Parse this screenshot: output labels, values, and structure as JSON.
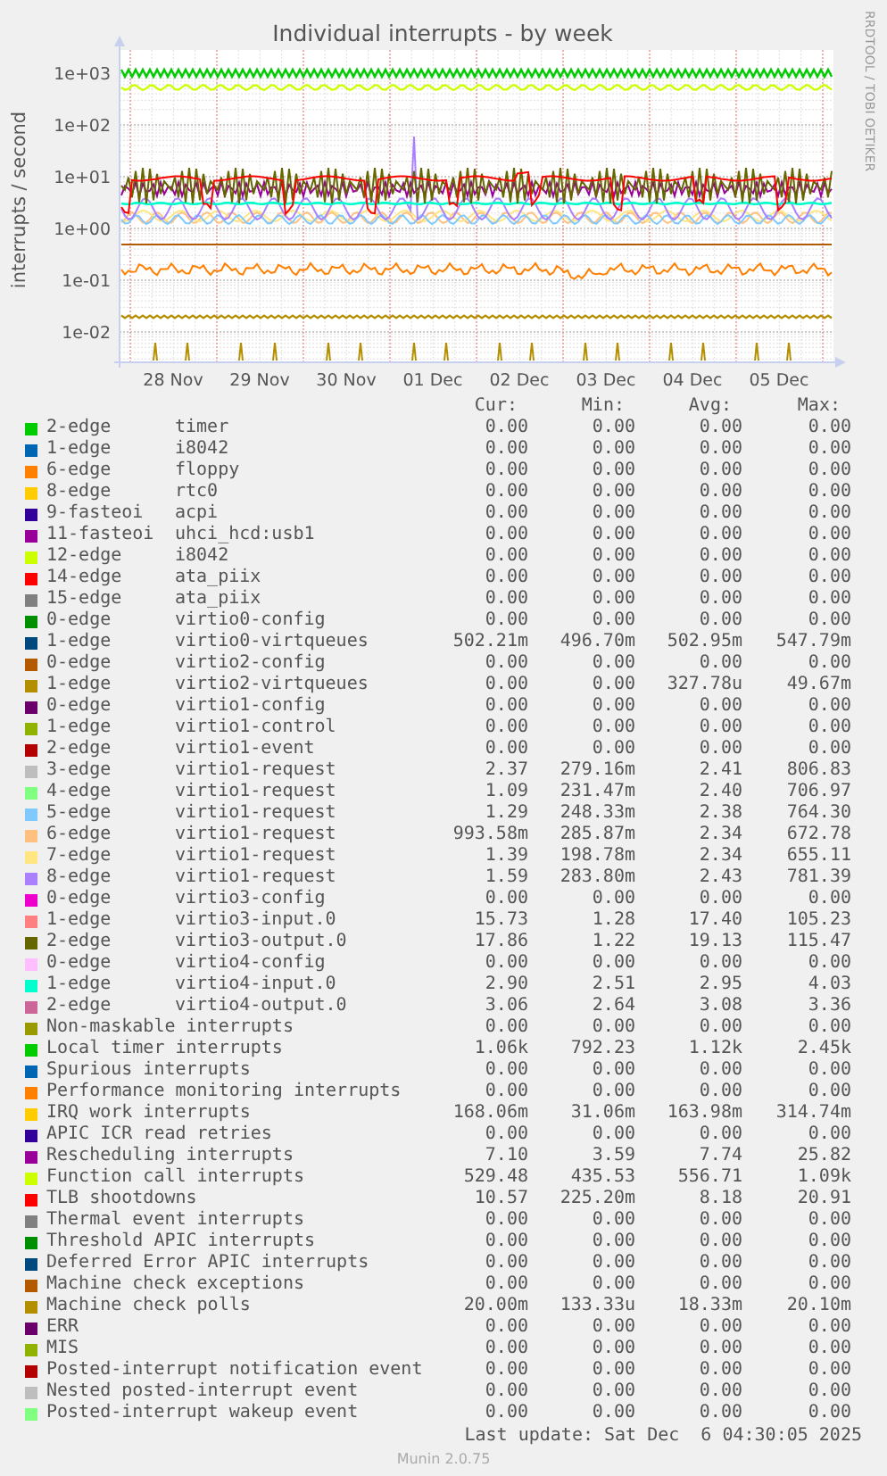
{
  "graph": {
    "title": "Individual interrupts - by week",
    "ylabel": "interrupts / second",
    "credit": "RRDTOOL / TOBI OETIKER",
    "y_tick_labels": [
      "1e+03",
      "1e+02",
      "1e+01",
      "1e+00",
      "1e-01",
      "1e-02"
    ],
    "x_tick_labels": [
      "28 Nov",
      "29 Nov",
      "30 Nov",
      "01 Dec",
      "02 Dec",
      "03 Dec",
      "04 Dec",
      "05 Dec"
    ]
  },
  "legend": {
    "columns": [
      "Cur:",
      "Min:",
      "Avg:",
      "Max:"
    ],
    "rows": [
      {
        "color": "#00cc00",
        "label": "2-edge",
        "name": "timer",
        "cur": "0.00",
        "min": "0.00",
        "avg": "0.00",
        "max": "0.00"
      },
      {
        "color": "#0066b3",
        "label": "1-edge",
        "name": "i8042",
        "cur": "0.00",
        "min": "0.00",
        "avg": "0.00",
        "max": "0.00"
      },
      {
        "color": "#ff8000",
        "label": "6-edge",
        "name": "floppy",
        "cur": "0.00",
        "min": "0.00",
        "avg": "0.00",
        "max": "0.00"
      },
      {
        "color": "#ffcc00",
        "label": "8-edge",
        "name": "rtc0",
        "cur": "0.00",
        "min": "0.00",
        "avg": "0.00",
        "max": "0.00"
      },
      {
        "color": "#330099",
        "label": "9-fasteoi",
        "name": "acpi",
        "cur": "0.00",
        "min": "0.00",
        "avg": "0.00",
        "max": "0.00"
      },
      {
        "color": "#990099",
        "label": "11-fasteoi",
        "name": "uhci_hcd:usb1",
        "cur": "0.00",
        "min": "0.00",
        "avg": "0.00",
        "max": "0.00"
      },
      {
        "color": "#ccff00",
        "label": "12-edge",
        "name": "i8042",
        "cur": "0.00",
        "min": "0.00",
        "avg": "0.00",
        "max": "0.00"
      },
      {
        "color": "#ff0000",
        "label": "14-edge",
        "name": "ata_piix",
        "cur": "0.00",
        "min": "0.00",
        "avg": "0.00",
        "max": "0.00"
      },
      {
        "color": "#808080",
        "label": "15-edge",
        "name": "ata_piix",
        "cur": "0.00",
        "min": "0.00",
        "avg": "0.00",
        "max": "0.00"
      },
      {
        "color": "#008f00",
        "label": "0-edge",
        "name": "virtio0-config",
        "cur": "0.00",
        "min": "0.00",
        "avg": "0.00",
        "max": "0.00"
      },
      {
        "color": "#00487d",
        "label": "1-edge",
        "name": "virtio0-virtqueues",
        "cur": "502.21m",
        "min": "496.70m",
        "avg": "502.95m",
        "max": "547.79m"
      },
      {
        "color": "#b35a00",
        "label": "0-edge",
        "name": "virtio2-config",
        "cur": "0.00",
        "min": "0.00",
        "avg": "0.00",
        "max": "0.00"
      },
      {
        "color": "#b38f00",
        "label": "1-edge",
        "name": "virtio2-virtqueues",
        "cur": "0.00",
        "min": "0.00",
        "avg": "327.78u",
        "max": "49.67m"
      },
      {
        "color": "#6b006b",
        "label": "0-edge",
        "name": "virtio1-config",
        "cur": "0.00",
        "min": "0.00",
        "avg": "0.00",
        "max": "0.00"
      },
      {
        "color": "#8fb300",
        "label": "1-edge",
        "name": "virtio1-control",
        "cur": "0.00",
        "min": "0.00",
        "avg": "0.00",
        "max": "0.00"
      },
      {
        "color": "#b30000",
        "label": "2-edge",
        "name": "virtio1-event",
        "cur": "0.00",
        "min": "0.00",
        "avg": "0.00",
        "max": "0.00"
      },
      {
        "color": "#bebebe",
        "label": "3-edge",
        "name": "virtio1-request",
        "cur": "2.37",
        "min": "279.16m",
        "avg": "2.41",
        "max": "806.83"
      },
      {
        "color": "#80ff80",
        "label": "4-edge",
        "name": "virtio1-request",
        "cur": "1.09",
        "min": "231.47m",
        "avg": "2.40",
        "max": "706.97"
      },
      {
        "color": "#80c9ff",
        "label": "5-edge",
        "name": "virtio1-request",
        "cur": "1.29",
        "min": "248.33m",
        "avg": "2.38",
        "max": "764.30"
      },
      {
        "color": "#ffc080",
        "label": "6-edge",
        "name": "virtio1-request",
        "cur": "993.58m",
        "min": "285.87m",
        "avg": "2.34",
        "max": "672.78"
      },
      {
        "color": "#ffe680",
        "label": "7-edge",
        "name": "virtio1-request",
        "cur": "1.39",
        "min": "198.78m",
        "avg": "2.34",
        "max": "655.11"
      },
      {
        "color": "#aa80ff",
        "label": "8-edge",
        "name": "virtio1-request",
        "cur": "1.59",
        "min": "283.80m",
        "avg": "2.43",
        "max": "781.39"
      },
      {
        "color": "#ee00cc",
        "label": "0-edge",
        "name": "virtio3-config",
        "cur": "0.00",
        "min": "0.00",
        "avg": "0.00",
        "max": "0.00"
      },
      {
        "color": "#ff8080",
        "label": "1-edge",
        "name": "virtio3-input.0",
        "cur": "15.73",
        "min": "1.28",
        "avg": "17.40",
        "max": "105.23"
      },
      {
        "color": "#666600",
        "label": "2-edge",
        "name": "virtio3-output.0",
        "cur": "17.86",
        "min": "1.22",
        "avg": "19.13",
        "max": "115.47"
      },
      {
        "color": "#ffbfff",
        "label": "0-edge",
        "name": "virtio4-config",
        "cur": "0.00",
        "min": "0.00",
        "avg": "0.00",
        "max": "0.00"
      },
      {
        "color": "#00ffcc",
        "label": "1-edge",
        "name": "virtio4-input.0",
        "cur": "2.90",
        "min": "2.51",
        "avg": "2.95",
        "max": "4.03"
      },
      {
        "color": "#cc6699",
        "label": "2-edge",
        "name": "virtio4-output.0",
        "cur": "3.06",
        "min": "2.64",
        "avg": "3.08",
        "max": "3.36"
      },
      {
        "color": "#999900",
        "label": "Non-maskable interrupts",
        "cur": "0.00",
        "min": "0.00",
        "avg": "0.00",
        "max": "0.00"
      },
      {
        "color": "#00cc00",
        "label": "Local timer interrupts",
        "cur": "1.06k",
        "min": "792.23",
        "avg": "1.12k",
        "max": "2.45k"
      },
      {
        "color": "#0066b3",
        "label": "Spurious interrupts",
        "cur": "0.00",
        "min": "0.00",
        "avg": "0.00",
        "max": "0.00"
      },
      {
        "color": "#ff8000",
        "label": "Performance monitoring interrupts",
        "cur": "0.00",
        "min": "0.00",
        "avg": "0.00",
        "max": "0.00"
      },
      {
        "color": "#ffcc00",
        "label": "IRQ work interrupts",
        "cur": "168.06m",
        "min": "31.06m",
        "avg": "163.98m",
        "max": "314.74m"
      },
      {
        "color": "#330099",
        "label": "APIC ICR read retries",
        "cur": "0.00",
        "min": "0.00",
        "avg": "0.00",
        "max": "0.00"
      },
      {
        "color": "#990099",
        "label": "Rescheduling interrupts",
        "cur": "7.10",
        "min": "3.59",
        "avg": "7.74",
        "max": "25.82"
      },
      {
        "color": "#ccff00",
        "label": "Function call interrupts",
        "cur": "529.48",
        "min": "435.53",
        "avg": "556.71",
        "max": "1.09k"
      },
      {
        "color": "#ff0000",
        "label": "TLB shootdowns",
        "cur": "10.57",
        "min": "225.20m",
        "avg": "8.18",
        "max": "20.91"
      },
      {
        "color": "#808080",
        "label": "Thermal event interrupts",
        "cur": "0.00",
        "min": "0.00",
        "avg": "0.00",
        "max": "0.00"
      },
      {
        "color": "#008f00",
        "label": "Threshold APIC interrupts",
        "cur": "0.00",
        "min": "0.00",
        "avg": "0.00",
        "max": "0.00"
      },
      {
        "color": "#00487d",
        "label": "Deferred Error APIC interrupts",
        "cur": "0.00",
        "min": "0.00",
        "avg": "0.00",
        "max": "0.00"
      },
      {
        "color": "#b35a00",
        "label": "Machine check exceptions",
        "cur": "0.00",
        "min": "0.00",
        "avg": "0.00",
        "max": "0.00"
      },
      {
        "color": "#b38f00",
        "label": "Machine check polls",
        "cur": "20.00m",
        "min": "133.33u",
        "avg": "18.33m",
        "max": "20.10m"
      },
      {
        "color": "#6b006b",
        "label": "ERR",
        "cur": "0.00",
        "min": "0.00",
        "avg": "0.00",
        "max": "0.00"
      },
      {
        "color": "#8fb300",
        "label": "MIS",
        "cur": "0.00",
        "min": "0.00",
        "avg": "0.00",
        "max": "0.00"
      },
      {
        "color": "#b30000",
        "label": "Posted-interrupt notification event",
        "cur": "0.00",
        "min": "0.00",
        "avg": "0.00",
        "max": "0.00"
      },
      {
        "color": "#bebebe",
        "label": "Nested posted-interrupt event",
        "cur": "0.00",
        "min": "0.00",
        "avg": "0.00",
        "max": "0.00"
      },
      {
        "color": "#80ff80",
        "label": "Posted-interrupt wakeup event",
        "cur": "0.00",
        "min": "0.00",
        "avg": "0.00",
        "max": "0.00"
      }
    ]
  },
  "last_update": "Last update: Sat Dec  6 04:30:05 2025",
  "footer": "Munin 2.0.75"
}
